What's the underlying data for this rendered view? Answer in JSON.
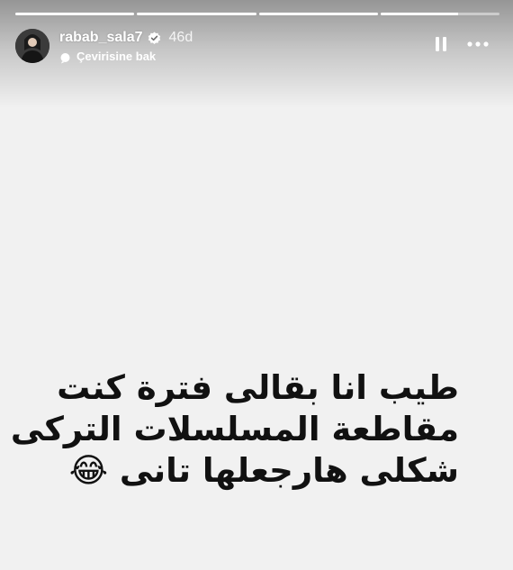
{
  "progress_segments": [
    {
      "fill": 1.0
    },
    {
      "fill": 1.0
    },
    {
      "fill": 1.0
    },
    {
      "fill": 0.65
    }
  ],
  "header": {
    "username": "rabab_sala7",
    "verified": true,
    "time_ago": "46d",
    "translate_label": "Çevirisine bak"
  },
  "controls": {
    "pause_icon": "pause-icon",
    "more_icon": "more-options-icon"
  },
  "story": {
    "lines": [
      "طيب انا بقالى فترة كنت",
      "مقاطعة المسلسلات التركى",
      "شكلى هارجعلها تانى 😂"
    ]
  },
  "colors": {
    "background": "#f1f1f1",
    "text": "#111111",
    "header_text": "#ffffff"
  }
}
